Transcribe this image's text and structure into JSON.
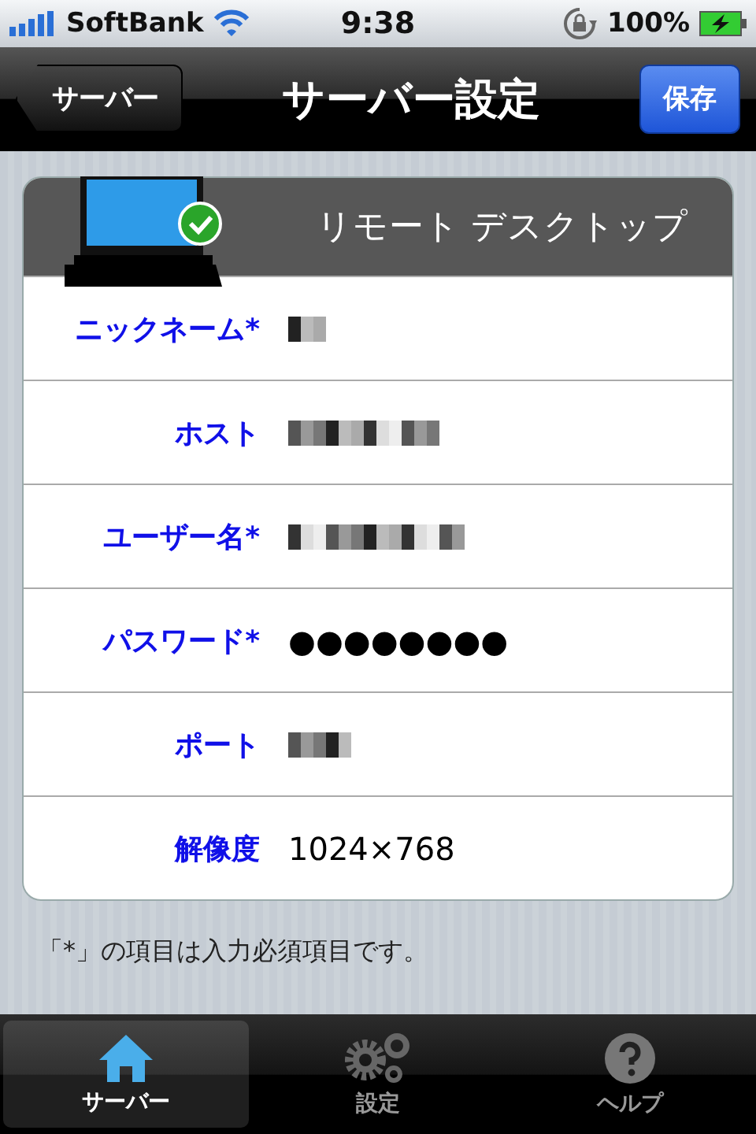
{
  "status_bar": {
    "carrier": "SoftBank",
    "time": "9:38",
    "battery": "100%"
  },
  "nav_bar": {
    "back": "サーバー",
    "title": "サーバー設定",
    "action": "保存"
  },
  "card": {
    "title": "リモート デスクトップ",
    "rows": [
      {
        "label": "ニックネーム*",
        "kind": "redacted"
      },
      {
        "label": "ホスト",
        "kind": "redacted"
      },
      {
        "label": "ユーザー名*",
        "kind": "redacted"
      },
      {
        "label": "パスワード*",
        "kind": "text",
        "value": "●●●●●●●●"
      },
      {
        "label": "ポート",
        "kind": "redacted"
      },
      {
        "label": "解像度",
        "kind": "text",
        "value": "1024×768"
      }
    ]
  },
  "note": "「*」の項目は入力必須項目です。",
  "tabs": [
    {
      "label": "サーバー",
      "selected": true,
      "kind": "home"
    },
    {
      "label": "設定",
      "selected": false,
      "kind": "gears"
    },
    {
      "label": "ヘルプ",
      "selected": false,
      "kind": "help"
    }
  ]
}
